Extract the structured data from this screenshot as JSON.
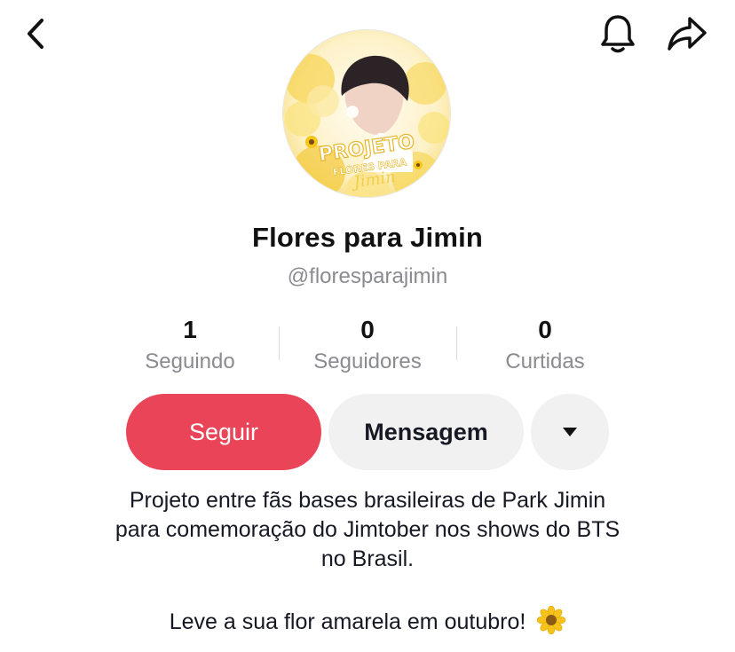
{
  "header": {
    "back_icon": "chevron-left-icon",
    "bell_icon": "bell-icon",
    "share_icon": "share-arrow-icon"
  },
  "profile": {
    "avatar_text_top": "PROJETO",
    "avatar_text_bottom": "FLORES PARA",
    "avatar_text_script": "Jimin",
    "display_name": "Flores para Jimin",
    "handle": "@floresparajimin"
  },
  "stats": [
    {
      "value": "1",
      "label": "Seguindo"
    },
    {
      "value": "0",
      "label": "Seguidores"
    },
    {
      "value": "0",
      "label": "Curtidas"
    }
  ],
  "actions": {
    "follow_label": "Seguir",
    "message_label": "Mensagem",
    "more_icon": "triangle-down-icon"
  },
  "bio": {
    "line1": "Projeto entre fãs bases brasileiras de Park Jimin",
    "line2": "para comemoração do Jimtober nos shows do BTS",
    "line3": "no Brasil.",
    "line4": "Leve a sua flor amarela em outubro!",
    "emoji_icon": "sunflower-icon"
  },
  "colors": {
    "follow_button": "#ea4459",
    "secondary_button": "#f1f1f2",
    "muted_text": "#8a8b91",
    "avatar_accent": "#f4d35e"
  }
}
